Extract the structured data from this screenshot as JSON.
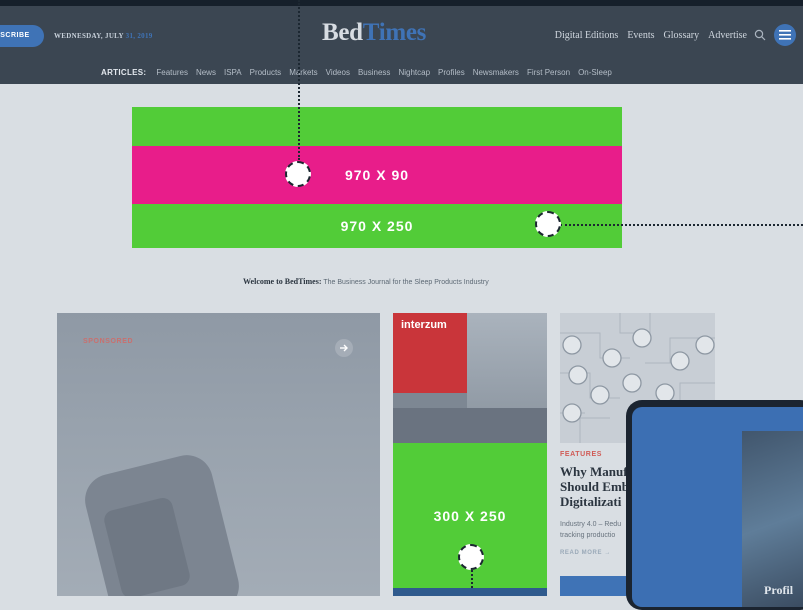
{
  "header": {
    "subscribe_label": "SCRIBE",
    "date_prefix": "WEDNESDAY, JULY",
    "date_suffix": "31, 2019",
    "logo_part1": "Bed",
    "logo_part2": "Times",
    "top_nav": [
      "Digital Editions",
      "Events",
      "Glossary",
      "Advertise"
    ],
    "articles_label": "ARTICLES:",
    "article_nav": [
      "Features",
      "News",
      "ISPA",
      "Products",
      "Markets",
      "Videos",
      "Business",
      "Nightcap",
      "Profiles",
      "Newsmakers",
      "First Person",
      "On-Sleep"
    ]
  },
  "ads": {
    "leaderboard_label": "970 X 90",
    "billboard_label": "970 X 250",
    "rectangle_label": "300 X 250"
  },
  "welcome": {
    "bold": "Welcome to BedTimes:",
    "rest": "The Business Journal for the Sleep Products Industry"
  },
  "hero": {
    "tag": "SPONSORED"
  },
  "mid_photo": {
    "banner_text": "interzum"
  },
  "feature": {
    "tag": "FEATURES",
    "title_lines": [
      "Why Manuf",
      "Should Emb",
      "Digitalizati"
    ],
    "excerpt_lines": [
      "Industry 4.0 – Redu",
      "tracking productio"
    ],
    "read_more": "READ MORE →"
  },
  "tablet": {
    "caption": "Profil"
  },
  "colors": {
    "header_bg": "#3b4652",
    "accent_blue": "#3f73b6",
    "ad_green": "#52cc38",
    "ad_pink": "#e81d8a",
    "page_bg": "#d9dee3"
  }
}
